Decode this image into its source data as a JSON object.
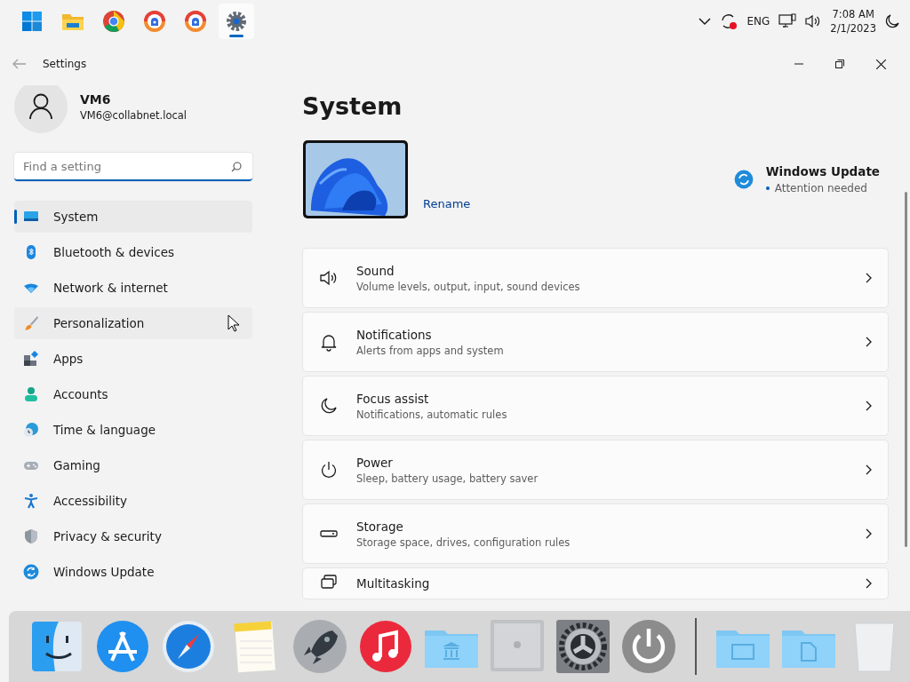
{
  "taskbar": {
    "apps": [
      {
        "kind": "start",
        "selected": false
      },
      {
        "kind": "explorer",
        "selected": false
      },
      {
        "kind": "chrome",
        "selected": false
      },
      {
        "kind": "browser",
        "selected": false
      },
      {
        "kind": "browser",
        "selected": false
      },
      {
        "kind": "settings",
        "selected": true
      }
    ],
    "language": "ENG",
    "time": "7:08 AM",
    "date": "2/1/2023"
  },
  "window": {
    "title": "Settings"
  },
  "user": {
    "name": "VM6",
    "email": "VM6@collabnet.local"
  },
  "search": {
    "placeholder": "Find a setting"
  },
  "nav": [
    {
      "kind": "system",
      "label": "System",
      "selected": true,
      "hovered": false
    },
    {
      "kind": "bluetooth",
      "label": "Bluetooth & devices",
      "selected": false,
      "hovered": false
    },
    {
      "kind": "network",
      "label": "Network & internet",
      "selected": false,
      "hovered": false
    },
    {
      "kind": "brush",
      "label": "Personalization",
      "selected": false,
      "hovered": true
    },
    {
      "kind": "apps",
      "label": "Apps",
      "selected": false,
      "hovered": false
    },
    {
      "kind": "accounts",
      "label": "Accounts",
      "selected": false,
      "hovered": false
    },
    {
      "kind": "time",
      "label": "Time & language",
      "selected": false,
      "hovered": false
    },
    {
      "kind": "gaming",
      "label": "Gaming",
      "selected": false,
      "hovered": false
    },
    {
      "kind": "accessibility",
      "label": "Accessibility",
      "selected": false,
      "hovered": false
    },
    {
      "kind": "privacy",
      "label": "Privacy & security",
      "selected": false,
      "hovered": false
    },
    {
      "kind": "update",
      "label": "Windows Update",
      "selected": false,
      "hovered": false
    }
  ],
  "page_title": "System",
  "device": {
    "rename": "Rename"
  },
  "update": {
    "title": "Windows Update",
    "status": "Attention needed"
  },
  "settings": [
    {
      "kind": "sound",
      "title": "Sound",
      "description": "Volume levels, output, input, sound devices"
    },
    {
      "kind": "notifications",
      "title": "Notifications",
      "description": "Alerts from apps and system"
    },
    {
      "kind": "focus",
      "title": "Focus assist",
      "description": "Notifications, automatic rules"
    },
    {
      "kind": "power",
      "title": "Power",
      "description": "Sleep, battery usage, battery saver"
    },
    {
      "kind": "storage",
      "title": "Storage",
      "description": "Storage space, drives, configuration rules"
    },
    {
      "kind": "multitasking",
      "title": "Multitasking"
    }
  ],
  "dock": [
    {
      "kind": "finder"
    },
    {
      "kind": "appstore"
    },
    {
      "kind": "safari"
    },
    {
      "kind": "notes"
    },
    {
      "kind": "launchpad"
    },
    {
      "kind": "music"
    },
    {
      "kind": "bank-folder"
    },
    {
      "kind": "computer"
    },
    {
      "kind": "gear"
    },
    {
      "kind": "power"
    },
    {
      "kind": "divider"
    },
    {
      "kind": "folder"
    },
    {
      "kind": "doc-folder"
    },
    {
      "kind": "trash"
    }
  ]
}
